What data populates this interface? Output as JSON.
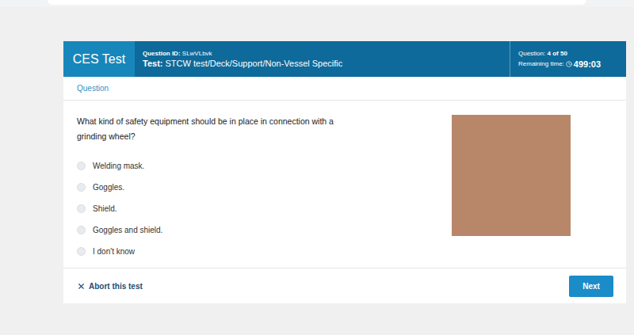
{
  "header": {
    "brand": "CES Test",
    "question_id_label": "Question ID:",
    "question_id": "SLwVLbvk",
    "test_label": "Test:",
    "test_name": "STCW test/Deck/Support/Non-Vessel Specific",
    "progress_label": "Question:",
    "progress": "4 of 50",
    "time_label": "Remaining time:",
    "time": "499:03"
  },
  "section_label": "Question",
  "question": "What kind of safety equipment should be in place in connection with a grinding wheel?",
  "options": [
    {
      "label": "Welding mask.",
      "selected": false
    },
    {
      "label": "Goggles.",
      "selected": false
    },
    {
      "label": "Shield.",
      "selected": false
    },
    {
      "label": "Goggles and shield.",
      "selected": false
    },
    {
      "label": "I don't know",
      "selected": false
    }
  ],
  "abort": "Abort this test",
  "next": "Next"
}
